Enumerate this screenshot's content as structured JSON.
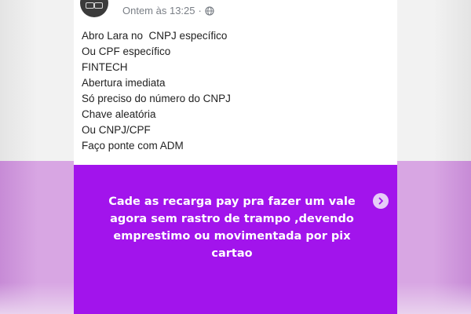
{
  "post": {
    "timestamp": "Ontem às 13:25",
    "separator": "·",
    "audience_icon": "globe-icon",
    "lines": [
      "Abro Lara no  CNPJ específico",
      "Ou CPF específico",
      "FINTECH",
      "Abertura imediata",
      "Só preciso do número do CNPJ",
      "Chave aleatória",
      "Ou CNPJ/CPF",
      "Faço ponte com ADM"
    ]
  },
  "card": {
    "text": "Cade as recarga pay pra fazer um vale agora sem rastro de trampo ,devendo emprestimo ou movimentada por pix cartao",
    "background": "#a214ec",
    "next_icon": "chevron-right-icon"
  }
}
